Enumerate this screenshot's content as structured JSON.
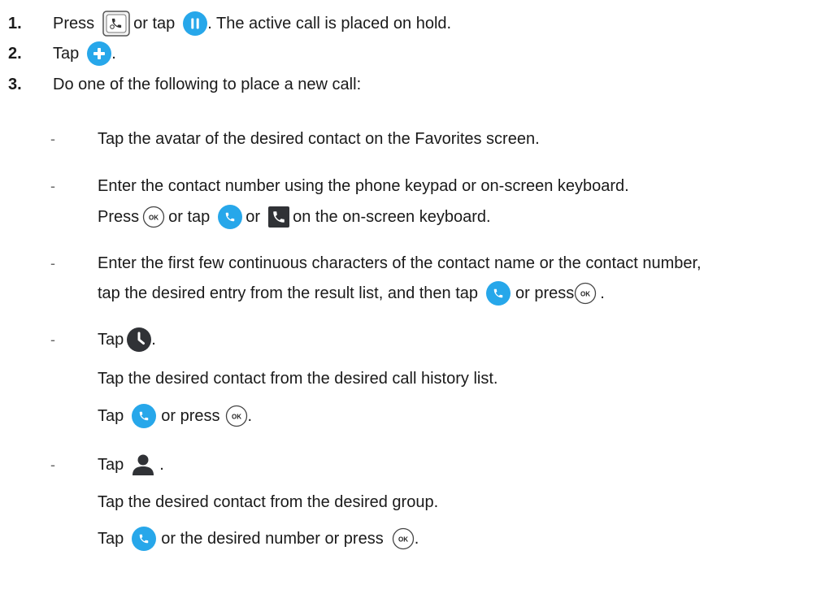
{
  "steps": [
    {
      "number": "1.",
      "parts": [
        "Press",
        "or tap",
        ". The active call is placed on hold."
      ]
    },
    {
      "number": "2.",
      "parts": [
        "Tap",
        "."
      ]
    },
    {
      "number": "3.",
      "parts": [
        "Do one of the following to place a new call:"
      ]
    }
  ],
  "options": [
    {
      "dash": "-",
      "lines": [
        [
          "Tap the avatar of the desired contact on the Favorites screen."
        ]
      ]
    },
    {
      "dash": "-",
      "lines": [
        [
          "Enter the contact number using the phone keypad or on-screen keyboard."
        ],
        [
          "Press",
          "or tap",
          "or",
          "on the on-screen keyboard."
        ]
      ]
    },
    {
      "dash": "-",
      "lines": [
        [
          "Enter the first few continuous characters of the contact name or the contact number,"
        ],
        [
          "tap the desired entry from the result list, and then tap",
          "or press",
          "."
        ]
      ]
    },
    {
      "dash": "-",
      "lines": [
        [
          "Tap",
          "."
        ],
        [
          "Tap the desired contact from the desired call history list."
        ],
        [
          "Tap",
          "or press",
          "."
        ]
      ]
    },
    {
      "dash": "-",
      "lines": [
        [
          "Tap",
          "."
        ],
        [
          "Tap the desired contact from the desired group."
        ],
        [
          "Tap",
          "or the desired number or press",
          "."
        ]
      ]
    }
  ],
  "icons": {
    "hold_key": "hold-key-icon",
    "hold_button": "pause-icon",
    "add_button": "plus-icon",
    "ok_key": "ok-key-icon",
    "ok_key_label": "OK",
    "call_button": "call-icon",
    "keyboard_call": "keyboard-call-icon",
    "history": "history-icon",
    "directory": "contact-icon"
  },
  "colors": {
    "accent_blue": "#27a7ea",
    "icon_dark": "#303236",
    "text": "#1a1a1a"
  }
}
